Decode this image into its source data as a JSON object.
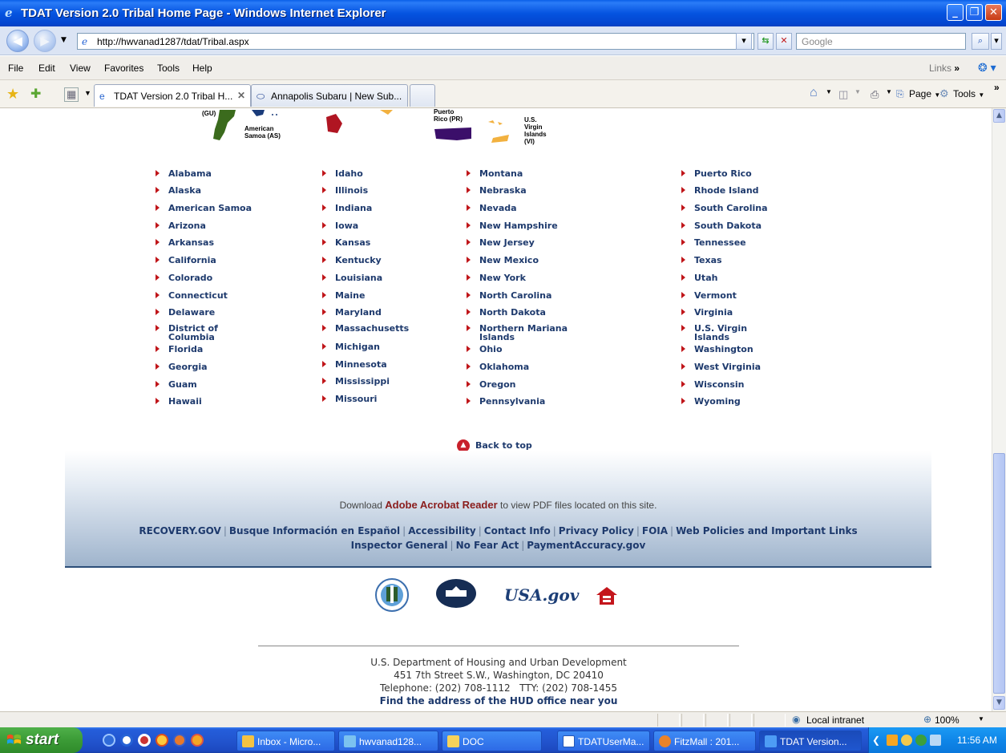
{
  "window": {
    "title": "TDAT Version 2.0 Tribal Home Page - Windows Internet Explorer"
  },
  "address_bar": {
    "url": "http://hwvanad1287/tdat/Tribal.aspx",
    "search_placeholder": "Google"
  },
  "menu": {
    "items": [
      "File",
      "Edit",
      "View",
      "Favorites",
      "Tools",
      "Help"
    ],
    "links_label": "Links"
  },
  "tabs": [
    {
      "label": "TDAT Version 2.0 Tribal H...",
      "active": true
    },
    {
      "label": "Annapolis Subaru | New Sub...",
      "active": false
    }
  ],
  "commands": {
    "page": "Page",
    "tools": "Tools"
  },
  "map_labels": {
    "gu": "(GU)",
    "american_samoa": [
      "American",
      "Samoa (AS)"
    ],
    "puerto_rico": [
      "Puerto",
      "Rico (PR)"
    ],
    "virgin_islands": [
      "U.S.",
      "Virgin",
      "Islands",
      "(VI)"
    ]
  },
  "states": {
    "col1": [
      "Alabama",
      "Alaska",
      "American Samoa",
      "Arizona",
      "Arkansas",
      "California",
      "Colorado",
      "Connecticut",
      "Delaware",
      "District of Columbia",
      "Florida",
      "Georgia",
      "Guam",
      "Hawaii"
    ],
    "col2": [
      "Idaho",
      "Illinois",
      "Indiana",
      "Iowa",
      "Kansas",
      "Kentucky",
      "Louisiana",
      "Maine",
      "Maryland",
      "Massachusetts",
      "Michigan",
      "Minnesota",
      "Mississippi",
      "Missouri"
    ],
    "col3": [
      "Montana",
      "Nebraska",
      "Nevada",
      "New Hampshire",
      "New Jersey",
      "New Mexico",
      "New York",
      "North Carolina",
      "North Dakota",
      "Northern Mariana Islands",
      "Ohio",
      "Oklahoma",
      "Oregon",
      "Pennsylvania"
    ],
    "col4": [
      "Puerto Rico",
      "Rhode Island",
      "South Carolina",
      "South Dakota",
      "Tennessee",
      "Texas",
      "Utah",
      "Vermont",
      "Virginia",
      "U.S. Virgin Islands",
      "Washington",
      "West Virginia",
      "Wisconsin",
      "Wyoming"
    ]
  },
  "back_to_top": "Back to top",
  "footer": {
    "acrobat_pre": "Download",
    "acrobat_link": "Adobe Acrobat Reader",
    "acrobat_post": "to view PDF files located on this site.",
    "links_row1": [
      "RECOVERY.GOV",
      "Busque Información en Español",
      "Accessibility",
      "Contact Info",
      "Privacy Policy",
      "FOIA",
      "Web Policies and Important Links"
    ],
    "links_row2": [
      "Inspector General",
      "No Fear Act",
      "PaymentAccuracy.gov"
    ],
    "separator": "|",
    "usa_gov_logo": "USA.gov"
  },
  "address": {
    "line1": "U.S. Department of Housing and Urban Development",
    "line2": "451 7th Street S.W., Washington, DC 20410",
    "line3": "Telephone: (202) 708-1112   TTY: (202) 708-1455",
    "find_link": "Find the address of the HUD office near you"
  },
  "statusbar": {
    "zone": "Local intranet",
    "zoom": "100%"
  },
  "taskbar": {
    "start": "start",
    "tasks": [
      {
        "label": "Inbox - Micro...",
        "active": false
      },
      {
        "label": "hwvanad128...",
        "active": false
      },
      {
        "label": "DOC",
        "active": false
      },
      {
        "label": "TDATUserMa...",
        "active": false
      },
      {
        "label": "FitzMall : 201...",
        "active": false
      },
      {
        "label": "TDAT Version...",
        "active": true
      }
    ],
    "clock": "11:56 AM"
  },
  "colors": {
    "link": "#1e3a6d",
    "bullet": "#c0161a",
    "footer_rule": "#2c4e79"
  }
}
